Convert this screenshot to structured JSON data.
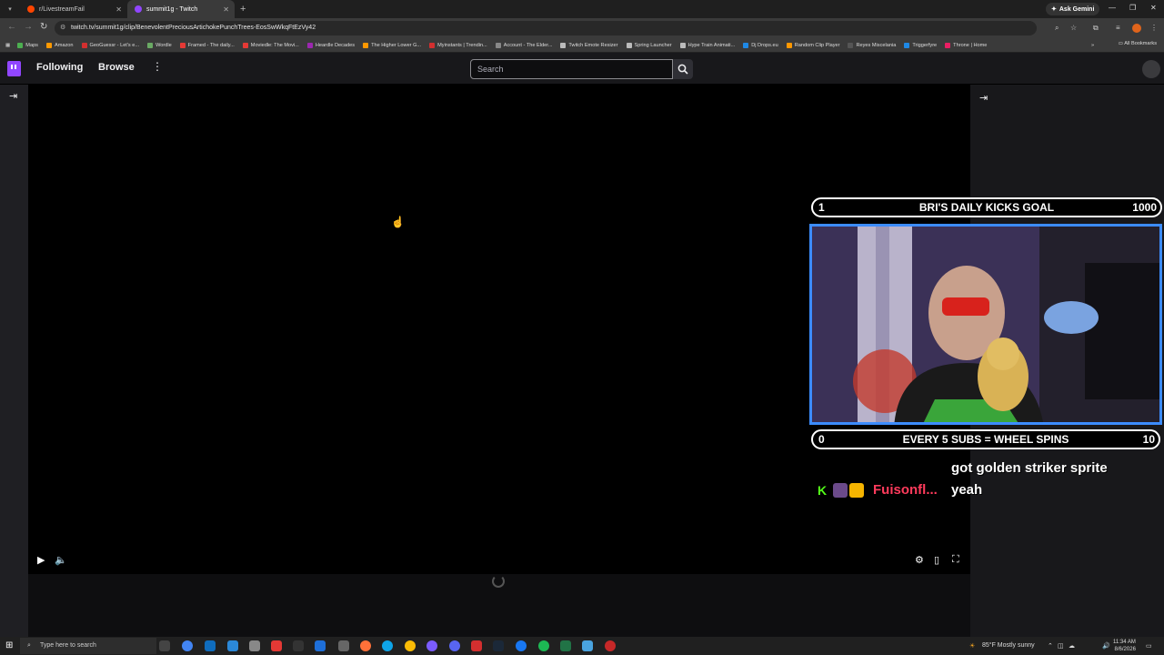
{
  "browser": {
    "tabs": [
      {
        "title": "r/LivestreamFail",
        "active": false,
        "color": "#ff4500"
      },
      {
        "title": "summit1g - Twitch",
        "active": true,
        "color": "#9146ff"
      }
    ],
    "ask_gemini": "Ask Gemini",
    "url": "twitch.tv/summit1g/clip/BenevolentPreciousArtichokePunchTrees-EosSwWkqFtEzVy42",
    "bookmarks": [
      {
        "label": "Maps",
        "color": "#4caf50"
      },
      {
        "label": "Amazon",
        "color": "#ff9900"
      },
      {
        "label": "GeoGuessr - Let's e...",
        "color": "#d32f2f"
      },
      {
        "label": "Wordle",
        "color": "#6aaa64"
      },
      {
        "label": "Framed - The daily...",
        "color": "#e53935"
      },
      {
        "label": "Moviedle: The Movi...",
        "color": "#e53935"
      },
      {
        "label": "Heardle Decades",
        "color": "#9c27b0"
      },
      {
        "label": "The Higher Lower G...",
        "color": "#ff9800"
      },
      {
        "label": "Myinstants | Trendin...",
        "color": "#d32f2f"
      },
      {
        "label": "Account - The Elder...",
        "color": "#888888"
      },
      {
        "label": "Twitch Emote Resizer",
        "color": "#bbbbbb"
      },
      {
        "label": "Spring Launcher",
        "color": "#bbbbbb"
      },
      {
        "label": "Hype Train Animati...",
        "color": "#bbbbbb"
      },
      {
        "label": "Dj Drops.eu",
        "color": "#1e88e5"
      },
      {
        "label": "Random Clip Player",
        "color": "#ff9800"
      },
      {
        "label": "Reyes Miscelania",
        "color": "#555555"
      },
      {
        "label": "Triggerfyre",
        "color": "#1e88e5"
      },
      {
        "label": "Throne | Home",
        "color": "#e91e63"
      }
    ],
    "all_bookmarks": "All Bookmarks"
  },
  "twitch": {
    "following": "Following",
    "browse": "Browse",
    "search_placeholder": "Search"
  },
  "overlay": {
    "goal1": {
      "left": "1",
      "center": "BRI'S DAILY KICKS GOAL",
      "right": "1000"
    },
    "goal2": {
      "left": "0",
      "center": "EVERY 5 SUBS = WHEEL SPINS",
      "right": "10"
    },
    "chat": {
      "username": "Fuisonfl...",
      "username_color": "#ff3b5c",
      "line1": "got golden striker sprite",
      "line2": "yeah"
    }
  },
  "taskbar": {
    "search_placeholder": "Type here to search",
    "weather": "85°F  Mostly sunny",
    "time": "11:34 AM",
    "date": "8/6/2026"
  }
}
